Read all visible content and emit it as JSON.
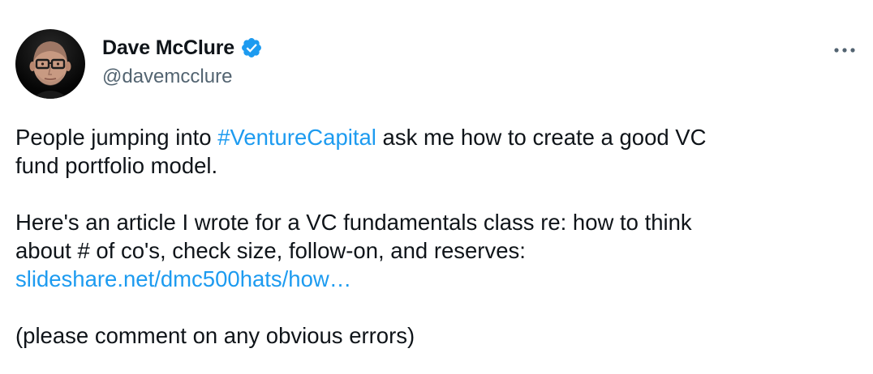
{
  "author": {
    "display_name": "Dave McClure",
    "handle": "@davemcclure",
    "verified": true,
    "verified_color": "#1d9bf0"
  },
  "menu": {
    "more_icon": "more-horizontal-icon"
  },
  "tweet": {
    "p1_before": "People jumping into ",
    "p1_hashtag": "#VentureCapital",
    "p1_after_line1": " ask me how to create a good VC",
    "p1_line2": "fund portfolio model.",
    "p2_line1": "Here's an article I wrote for a VC fundamentals class re: how to think",
    "p2_line2": "about # of co's, check size, follow-on, and reserves:",
    "p2_link": "slideshare.net/dmc500hats/how…",
    "p3": "(please comment on any obvious errors)"
  },
  "colors": {
    "text": "#0f1419",
    "secondary": "#536471",
    "link": "#1d9bf0"
  }
}
